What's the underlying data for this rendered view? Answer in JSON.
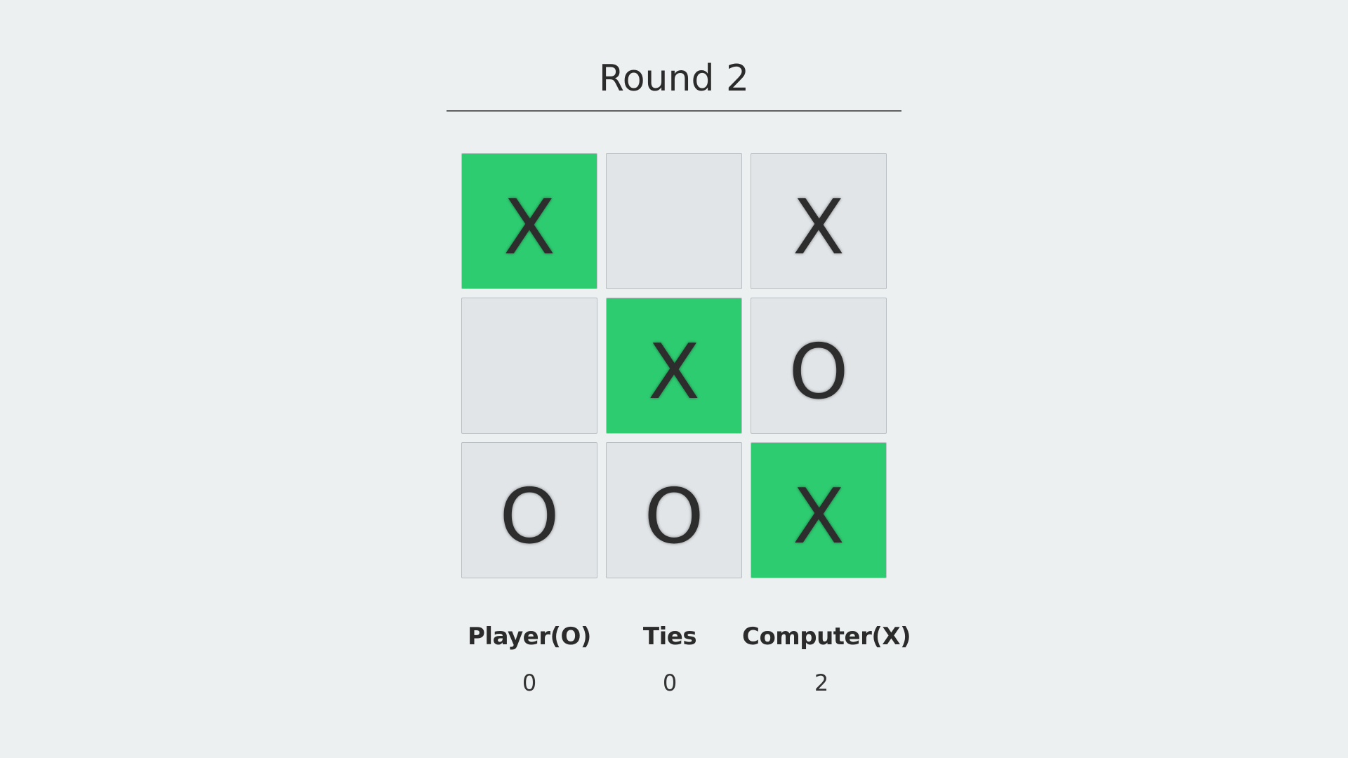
{
  "header": {
    "round_label": "Round 2"
  },
  "board": {
    "cells": [
      {
        "mark": "X",
        "winning": true
      },
      {
        "mark": "",
        "winning": false
      },
      {
        "mark": "X",
        "winning": false
      },
      {
        "mark": "",
        "winning": false
      },
      {
        "mark": "X",
        "winning": true
      },
      {
        "mark": "O",
        "winning": false
      },
      {
        "mark": "O",
        "winning": false
      },
      {
        "mark": "O",
        "winning": false
      },
      {
        "mark": "X",
        "winning": true
      }
    ]
  },
  "scores": {
    "player": {
      "label": "Player(O)",
      "value": "0"
    },
    "ties": {
      "label": "Ties",
      "value": "0"
    },
    "computer": {
      "label": "Computer(X)",
      "value": "2"
    }
  },
  "colors": {
    "background": "#ecf0f1",
    "cell": "#e1e5e8",
    "winning_cell": "#2ecc71",
    "text": "#2b2b2b"
  }
}
